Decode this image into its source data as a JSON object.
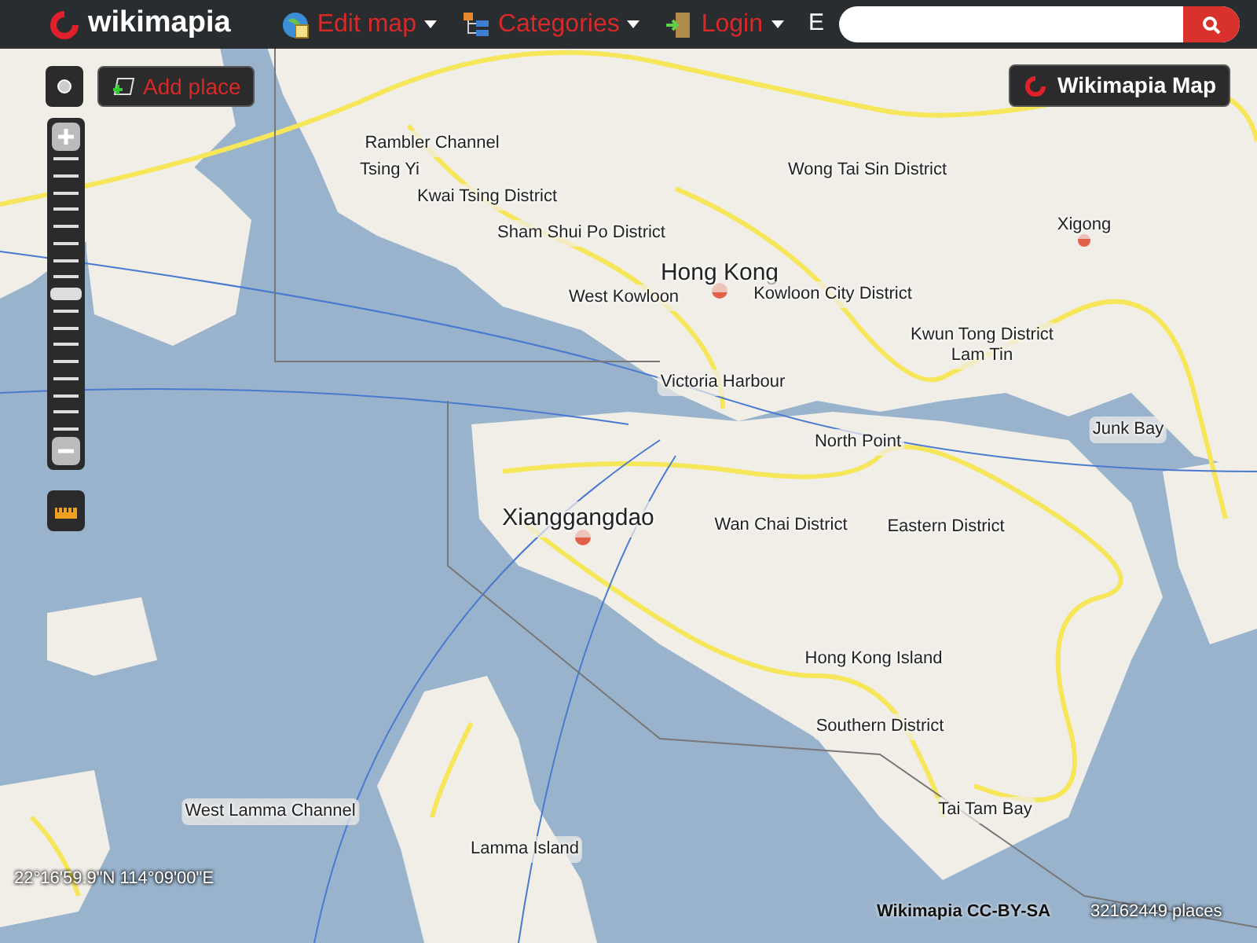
{
  "header": {
    "logo": "wikimapia",
    "menu": [
      {
        "label": "Edit map"
      },
      {
        "label": "Categories"
      },
      {
        "label": "Login"
      }
    ],
    "cut_text": "E"
  },
  "map_controls": {
    "add_place": "Add place",
    "zoom": {
      "level": 0.5
    }
  },
  "map_type_button": "Wikimapia Map",
  "map_labels": [
    {
      "text": "Rambler Channel",
      "kind": "place"
    },
    {
      "text": "Tsing Yi",
      "kind": "place"
    },
    {
      "text": "Kwai Tsing District",
      "kind": "place"
    },
    {
      "text": "Wong Tai Sin District",
      "kind": "place"
    },
    {
      "text": "Sham Shui Po District",
      "kind": "place"
    },
    {
      "text": "Xigong",
      "kind": "place"
    },
    {
      "text": "Hong Kong",
      "kind": "city"
    },
    {
      "text": "West Kowloon",
      "kind": "place"
    },
    {
      "text": "Kowloon City District",
      "kind": "place"
    },
    {
      "text": "Kwun Tong District",
      "kind": "place"
    },
    {
      "text": "Lam Tin",
      "kind": "place"
    },
    {
      "text": "Victoria Harbour",
      "kind": "place"
    },
    {
      "text": "Junk Bay",
      "kind": "place"
    },
    {
      "text": "North Point",
      "kind": "place"
    },
    {
      "text": "Xianggangdao",
      "kind": "city"
    },
    {
      "text": "Wan Chai District",
      "kind": "place"
    },
    {
      "text": "Eastern District",
      "kind": "place"
    },
    {
      "text": "Hong Kong Island",
      "kind": "place"
    },
    {
      "text": "Southern District",
      "kind": "place"
    },
    {
      "text": "West Lamma Channel",
      "kind": "place"
    },
    {
      "text": "Tai Tam Bay",
      "kind": "place"
    },
    {
      "text": "Lamma Island",
      "kind": "place"
    }
  ],
  "coordinates": "22°16'59.9\"N 114°09'00\"E",
  "attribution": "Wikimapia CC-BY-SA",
  "place_count": "32162449 places"
}
